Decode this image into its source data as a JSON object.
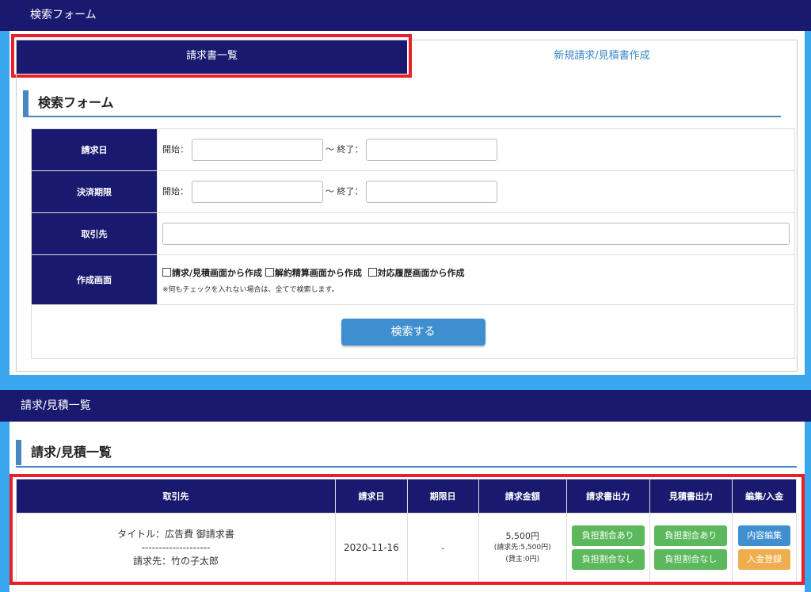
{
  "search_panel": {
    "header": "検索フォーム",
    "tabs": {
      "list": "請求書一覧",
      "create": "新規請求/見積書作成"
    },
    "section_title": "検索フォーム",
    "rows": {
      "invoice_date": {
        "label": "請求日",
        "start": "開始：",
        "end": "〜 終了："
      },
      "payment_due": {
        "label": "決済期限",
        "start": "開始：",
        "end": "〜 終了："
      },
      "client": {
        "label": "取引先"
      },
      "source": {
        "label": "作成画面",
        "options": [
          "請求/見積画面から作成",
          "解約精算画面から作成",
          "対応履歴画面から作成"
        ],
        "note": "※何もチェックを入れない場合は、全てで検索します。"
      }
    },
    "search_button": "検索する"
  },
  "list_panel": {
    "header": "請求/見積一覧",
    "section_title": "請求/見積一覧",
    "columns": [
      "取引先",
      "請求日",
      "期限日",
      "請求金額",
      "請求書出力",
      "見積書出力",
      "編集/入金"
    ],
    "rows": [
      {
        "title": "タイトル：広告費 御請求書",
        "divider": "--------------------",
        "client": "請求先：竹の子太郎",
        "invoice_date": "2020-11-16",
        "due_date": "-",
        "amount": "5,500円",
        "amount_client": "(請求先:5,500円)",
        "amount_owner": "(貸主:0円)",
        "invoice_out": [
          "負担割合あり",
          "負担割合なし"
        ],
        "estimate_out": [
          "負担割合あり",
          "負担割合なし"
        ],
        "edit": "内容編集",
        "payment": "入金登録"
      }
    ]
  },
  "colors": {
    "navy": "#191970",
    "accent_blue": "#3f8fd0",
    "green": "#5cb85c",
    "orange": "#f0ad4e",
    "highlight_red": "#e8202a"
  }
}
